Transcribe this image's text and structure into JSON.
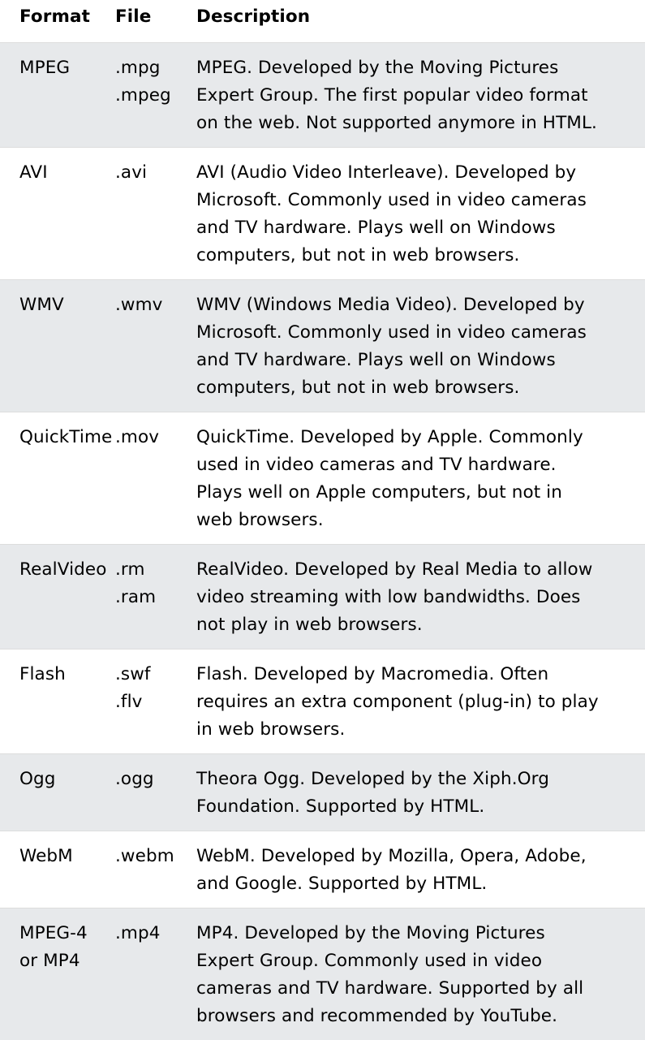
{
  "header": {
    "format": "Format",
    "file": "File",
    "description": "Description"
  },
  "rows": [
    {
      "format": [
        "MPEG"
      ],
      "files": [
        ".mpg",
        ".mpeg"
      ],
      "description": [
        "MPEG. Developed by the Moving Pictures",
        "Expert Group. The first popular video format",
        "on the web. Not supported anymore in HTML."
      ]
    },
    {
      "format": [
        "AVI"
      ],
      "files": [
        ".avi"
      ],
      "description": [
        "AVI (Audio Video Interleave). Developed by",
        "Microsoft. Commonly used in video cameras",
        "and TV hardware. Plays well on Windows",
        "computers, but not in web browsers."
      ]
    },
    {
      "format": [
        "WMV"
      ],
      "files": [
        ".wmv"
      ],
      "description": [
        "WMV (Windows Media Video). Developed by",
        "Microsoft. Commonly used in video cameras",
        "and TV hardware. Plays well on Windows",
        "computers, but not in web browsers."
      ]
    },
    {
      "format": [
        "QuickTime"
      ],
      "files": [
        ".mov"
      ],
      "description": [
        "QuickTime. Developed by Apple. Commonly",
        "used in video cameras and TV hardware.",
        "Plays well on Apple computers, but not in",
        "web browsers."
      ]
    },
    {
      "format": [
        "RealVideo"
      ],
      "files": [
        ".rm",
        ".ram"
      ],
      "description": [
        "RealVideo. Developed by Real Media to allow",
        "video streaming with low bandwidths. Does",
        "not play in web browsers."
      ]
    },
    {
      "format": [
        "Flash"
      ],
      "files": [
        ".swf",
        ".flv"
      ],
      "description": [
        "Flash. Developed by Macromedia. Often",
        "requires an extra component (plug-in) to play",
        "in web browsers."
      ]
    },
    {
      "format": [
        "Ogg"
      ],
      "files": [
        ".ogg"
      ],
      "description": [
        "Theora Ogg. Developed by the Xiph.Org",
        "Foundation. Supported by HTML."
      ]
    },
    {
      "format": [
        "WebM"
      ],
      "files": [
        ".webm"
      ],
      "description": [
        "WebM. Developed by Mozilla, Opera, Adobe,",
        "and Google. Supported by HTML."
      ]
    },
    {
      "format": [
        "MPEG-4",
        "or MP4"
      ],
      "files": [
        ".mp4"
      ],
      "description": [
        "MP4. Developed by the Moving Pictures",
        "Expert Group. Commonly used in video",
        "cameras and TV hardware. Supported by all",
        "browsers and  recommended by YouTube."
      ]
    }
  ]
}
